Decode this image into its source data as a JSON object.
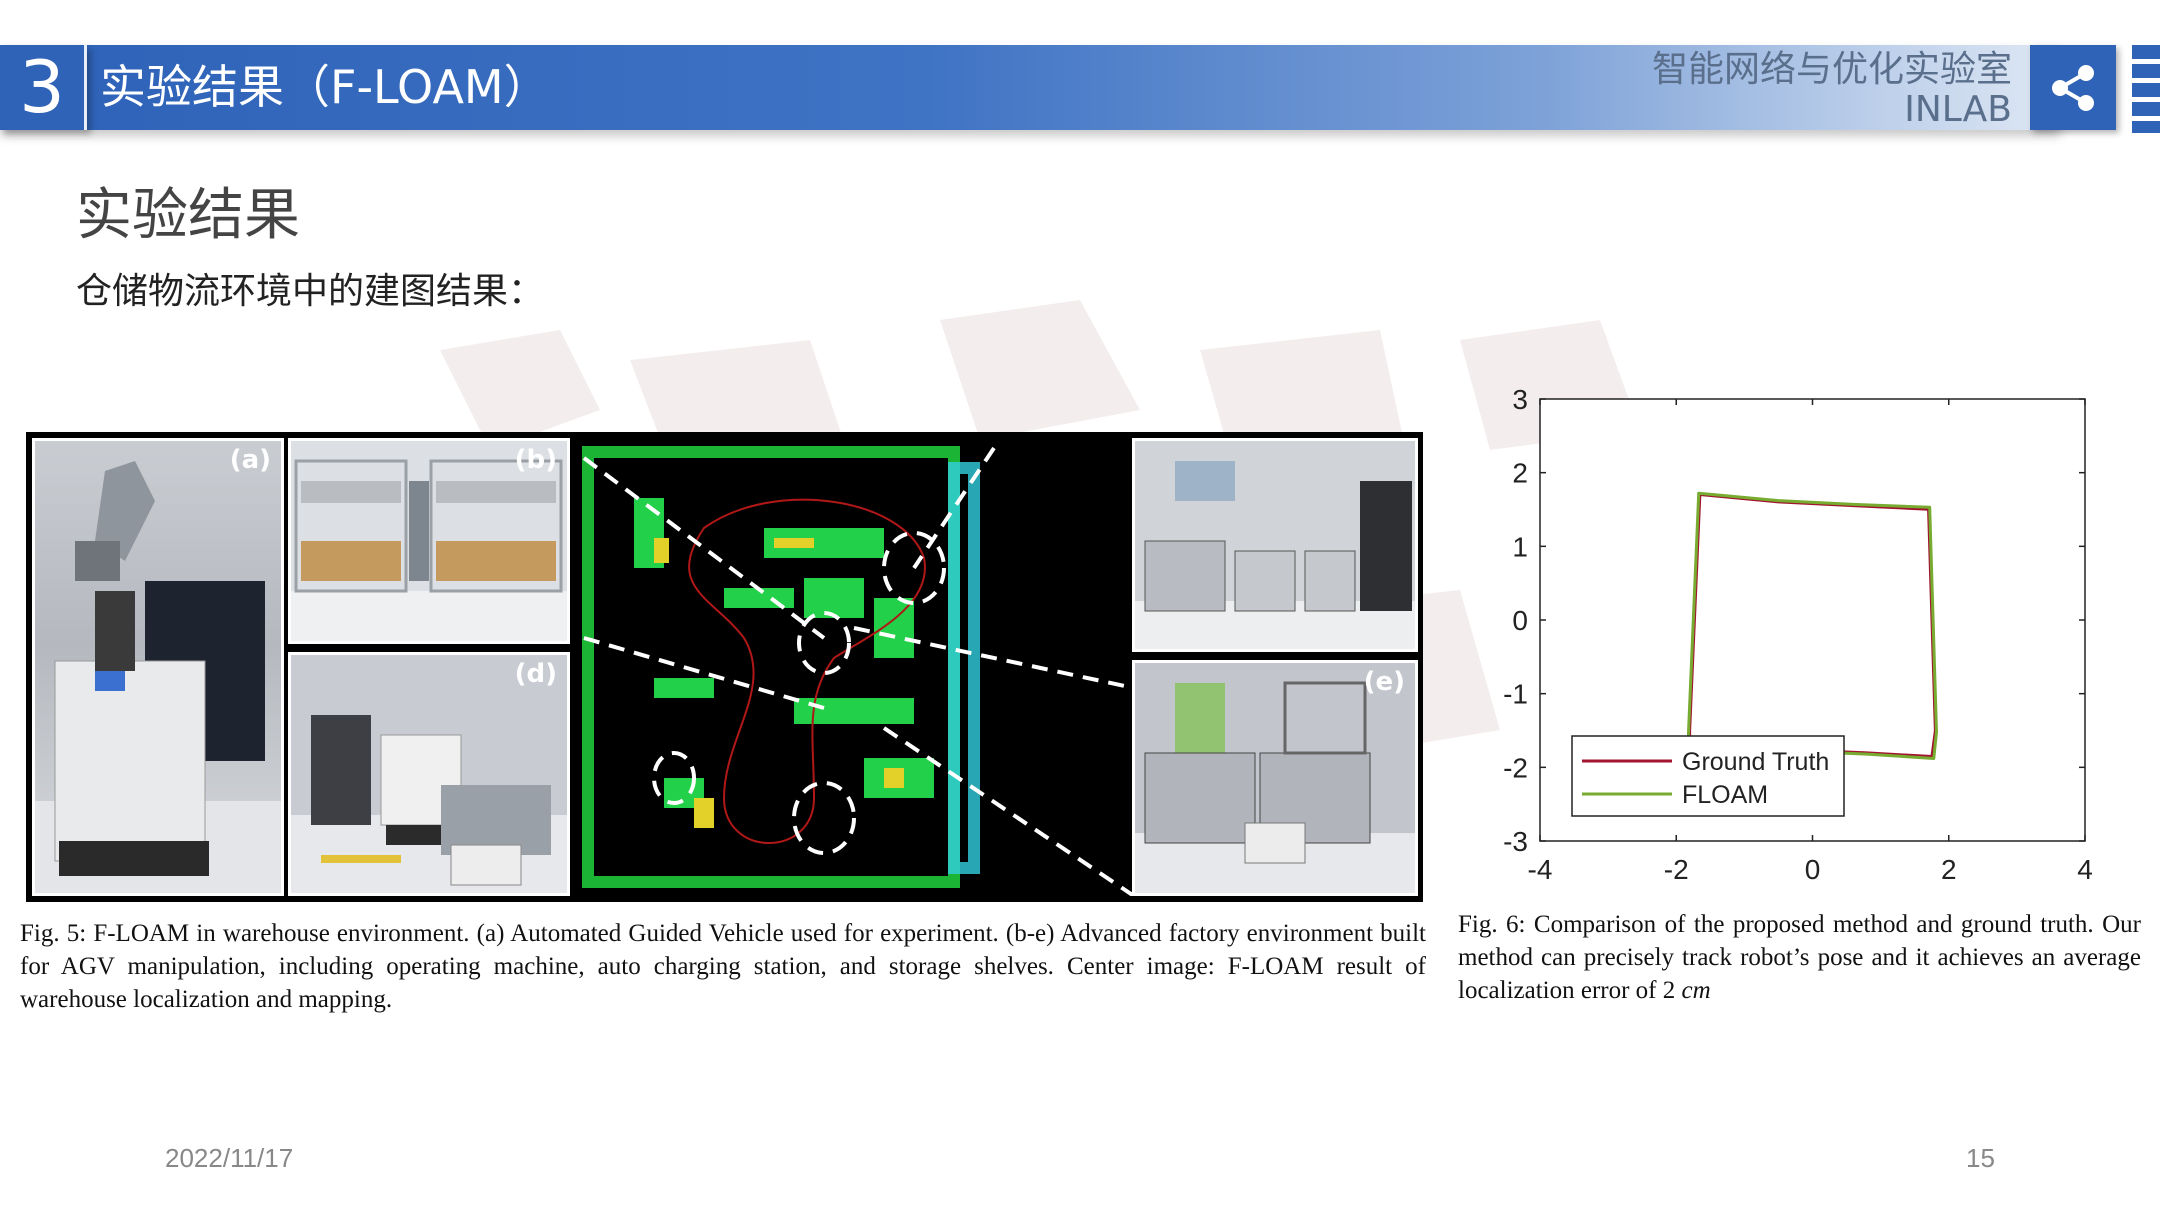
{
  "header": {
    "section_number": "3",
    "title": "实验结果（F-LOAM）",
    "lab_name_cn": "智能网络与优化实验室",
    "lab_name_en": "INLAB"
  },
  "main": {
    "heading": "实验结果",
    "subheading": "仓储物流环境中的建图结果："
  },
  "figure5": {
    "panel_labels": [
      "(a)",
      "(b)",
      "(d)",
      "(e)"
    ],
    "caption": "Fig. 5: F-LOAM in warehouse environment. (a) Automated Guided Vehicle used for experiment. (b-e) Advanced factory environment built for AGV manipulation, including operating machine, auto charging station, and storage shelves. Center image: F-LOAM result of warehouse localization and mapping."
  },
  "figure6": {
    "caption_main": "Fig. 6: Comparison of the proposed method and ground truth. Our method can precisely track robot’s pose and it achieves an average localization error of 2",
    "caption_unit": "cm"
  },
  "chart_data": {
    "type": "line",
    "title": "",
    "xlabel": "",
    "ylabel": "",
    "xlim": [
      -4,
      4
    ],
    "ylim": [
      -3,
      3
    ],
    "xticks": [
      -4,
      -2,
      0,
      2,
      4
    ],
    "yticks": [
      3,
      2,
      1,
      0,
      -1,
      -2,
      -3
    ],
    "grid": false,
    "legend_position": "bottom-left",
    "series": [
      {
        "name": "Ground Truth",
        "color": "#a2142f",
        "x": [
          -1.8,
          -1.65,
          -0.5,
          0.6,
          1.7,
          1.75,
          1.8,
          1.75,
          0.8,
          -0.5,
          -1.8,
          -1.8
        ],
        "y": [
          -1.5,
          1.7,
          1.6,
          1.55,
          1.5,
          0.0,
          -1.5,
          -1.85,
          -1.8,
          -1.75,
          -1.7,
          -1.5
        ]
      },
      {
        "name": "FLOAM",
        "color": "#77ac30",
        "x": [
          -1.82,
          -1.67,
          -0.5,
          0.6,
          1.72,
          1.77,
          1.82,
          1.78,
          0.8,
          -0.5,
          -1.82,
          -1.82
        ],
        "y": [
          -1.52,
          1.72,
          1.62,
          1.57,
          1.53,
          0.0,
          -1.52,
          -1.88,
          -1.82,
          -1.77,
          -1.72,
          -1.52
        ]
      }
    ]
  },
  "footer": {
    "date": "2022/11/17",
    "page_number": "15"
  },
  "colors": {
    "brand_blue": "#2f63b7",
    "ground_truth": "#a2142f",
    "floam": "#77ac30"
  }
}
